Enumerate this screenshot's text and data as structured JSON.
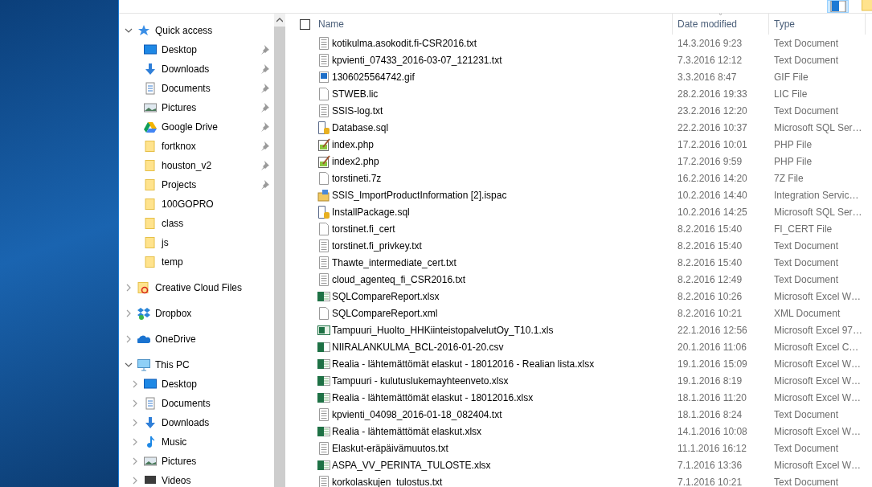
{
  "navigation": [
    {
      "label": "Quick access",
      "kind": "star",
      "expanded": true,
      "children": [
        {
          "label": "Desktop",
          "kind": "desktop",
          "pinned": true
        },
        {
          "label": "Downloads",
          "kind": "download",
          "pinned": true
        },
        {
          "label": "Documents",
          "kind": "document",
          "pinned": true
        },
        {
          "label": "Pictures",
          "kind": "picture",
          "pinned": true
        },
        {
          "label": "Google Drive",
          "kind": "drive",
          "pinned": true
        },
        {
          "label": "fortknox",
          "kind": "folder",
          "pinned": true
        },
        {
          "label": "houston_v2",
          "kind": "folder",
          "pinned": true
        },
        {
          "label": "Projects",
          "kind": "folder",
          "pinned": true
        },
        {
          "label": "100GOPRO",
          "kind": "folder",
          "pinned": false
        },
        {
          "label": "class",
          "kind": "folder",
          "pinned": false
        },
        {
          "label": "js",
          "kind": "folder",
          "pinned": false
        },
        {
          "label": "temp",
          "kind": "folder",
          "pinned": false
        }
      ]
    },
    {
      "label": "Creative Cloud Files",
      "kind": "cloudfolder",
      "expanded": false
    },
    {
      "label": "Dropbox",
      "kind": "dropbox",
      "expanded": false
    },
    {
      "label": "OneDrive",
      "kind": "onedrive",
      "expanded": false
    },
    {
      "label": "This PC",
      "kind": "pc",
      "expanded": true,
      "children": [
        {
          "label": "Desktop",
          "kind": "desktop",
          "expanded": false
        },
        {
          "label": "Documents",
          "kind": "document",
          "expanded": false
        },
        {
          "label": "Downloads",
          "kind": "download",
          "expanded": false
        },
        {
          "label": "Music",
          "kind": "music",
          "expanded": false
        },
        {
          "label": "Pictures",
          "kind": "picture",
          "expanded": false
        },
        {
          "label": "Videos",
          "kind": "video",
          "expanded": false
        }
      ]
    }
  ],
  "file_list": {
    "select_all": {
      "checked": false
    },
    "columns": [
      {
        "label": "Name",
        "sorted": false
      },
      {
        "label": "Date modified",
        "sorted": true
      },
      {
        "label": "Type",
        "sorted": false
      }
    ],
    "files": [
      {
        "name": "kotikulma.asokodit.fi-CSR2016.txt",
        "date": "14.3.2016 9:23",
        "type": "Text Document",
        "kind": "text"
      },
      {
        "name": "kpvienti_07433_2016-03-07_121231.txt",
        "date": "7.3.2016 12:12",
        "type": "Text Document",
        "kind": "text"
      },
      {
        "name": "1306025564742.gif",
        "date": "3.3.2016 8:47",
        "type": "GIF File",
        "kind": "image"
      },
      {
        "name": "STWEB.lic",
        "date": "28.2.2016 19:33",
        "type": "LIC File",
        "kind": "blank"
      },
      {
        "name": "SSIS-log.txt",
        "date": "23.2.2016 12:20",
        "type": "Text Document",
        "kind": "text"
      },
      {
        "name": "Database.sql",
        "date": "22.2.2016 10:37",
        "type": "Microsoft SQL Ser…",
        "kind": "sql"
      },
      {
        "name": "index.php",
        "date": "17.2.2016 10:01",
        "type": "PHP File",
        "kind": "php"
      },
      {
        "name": "index2.php",
        "date": "17.2.2016 9:59",
        "type": "PHP File",
        "kind": "php"
      },
      {
        "name": "torstineti.7z",
        "date": "16.2.2016 14:20",
        "type": "7Z File",
        "kind": "blank"
      },
      {
        "name": "SSIS_ImportProductInformation [2].ispac",
        "date": "10.2.2016 14:40",
        "type": "Integration Servic…",
        "kind": "package"
      },
      {
        "name": "InstallPackage.sql",
        "date": "10.2.2016 14:25",
        "type": "Microsoft SQL Ser…",
        "kind": "sql"
      },
      {
        "name": "torstinet.fi_cert",
        "date": "8.2.2016 15:40",
        "type": "FI_CERT File",
        "kind": "blank"
      },
      {
        "name": "torstinet.fi_privkey.txt",
        "date": "8.2.2016 15:40",
        "type": "Text Document",
        "kind": "text"
      },
      {
        "name": "Thawte_intermediate_cert.txt",
        "date": "8.2.2016 15:40",
        "type": "Text Document",
        "kind": "text"
      },
      {
        "name": "cloud_agenteq_fi_CSR2016.txt",
        "date": "8.2.2016 12:49",
        "type": "Text Document",
        "kind": "text"
      },
      {
        "name": "SQLCompareReport.xlsx",
        "date": "8.2.2016 10:26",
        "type": "Microsoft Excel W…",
        "kind": "excel"
      },
      {
        "name": "SQLCompareReport.xml",
        "date": "8.2.2016 10:21",
        "type": "XML Document",
        "kind": "blank"
      },
      {
        "name": "Tampuuri_Huolto_HHKiinteistopalvelutOy_T10.1.xls",
        "date": "22.1.2016 12:56",
        "type": "Microsoft Excel 97…",
        "kind": "excel97"
      },
      {
        "name": "NIIRALANKULMA_BCL-2016-01-20.csv",
        "date": "20.1.2016 11:06",
        "type": "Microsoft Excel C…",
        "kind": "csv"
      },
      {
        "name": "Realia - lähtemättömät elaskut - 18012016 - Realian lista.xlsx",
        "date": "19.1.2016 15:09",
        "type": "Microsoft Excel W…",
        "kind": "excel"
      },
      {
        "name": "Tampuuri - kulutuslukemayhteenveto.xlsx",
        "date": "19.1.2016 8:19",
        "type": "Microsoft Excel W…",
        "kind": "excel"
      },
      {
        "name": "Realia - lähtemättömät elaskut - 18012016.xlsx",
        "date": "18.1.2016 11:20",
        "type": "Microsoft Excel W…",
        "kind": "excel"
      },
      {
        "name": "kpvienti_04098_2016-01-18_082404.txt",
        "date": "18.1.2016 8:24",
        "type": "Text Document",
        "kind": "text"
      },
      {
        "name": "Realia - lähtemättömät elaskut.xlsx",
        "date": "14.1.2016 10:08",
        "type": "Microsoft Excel W…",
        "kind": "excel"
      },
      {
        "name": "Elaskut-eräpäivämuutos.txt",
        "date": "11.1.2016 16:12",
        "type": "Text Document",
        "kind": "text"
      },
      {
        "name": "ASPA_VV_PERINTA_TULOSTE.xlsx",
        "date": "7.1.2016 13:36",
        "type": "Microsoft Excel W…",
        "kind": "excel"
      },
      {
        "name": "korkolaskujen_tulostus.txt",
        "date": "7.1.2016 10:21",
        "type": "Text Document",
        "kind": "text"
      }
    ]
  }
}
